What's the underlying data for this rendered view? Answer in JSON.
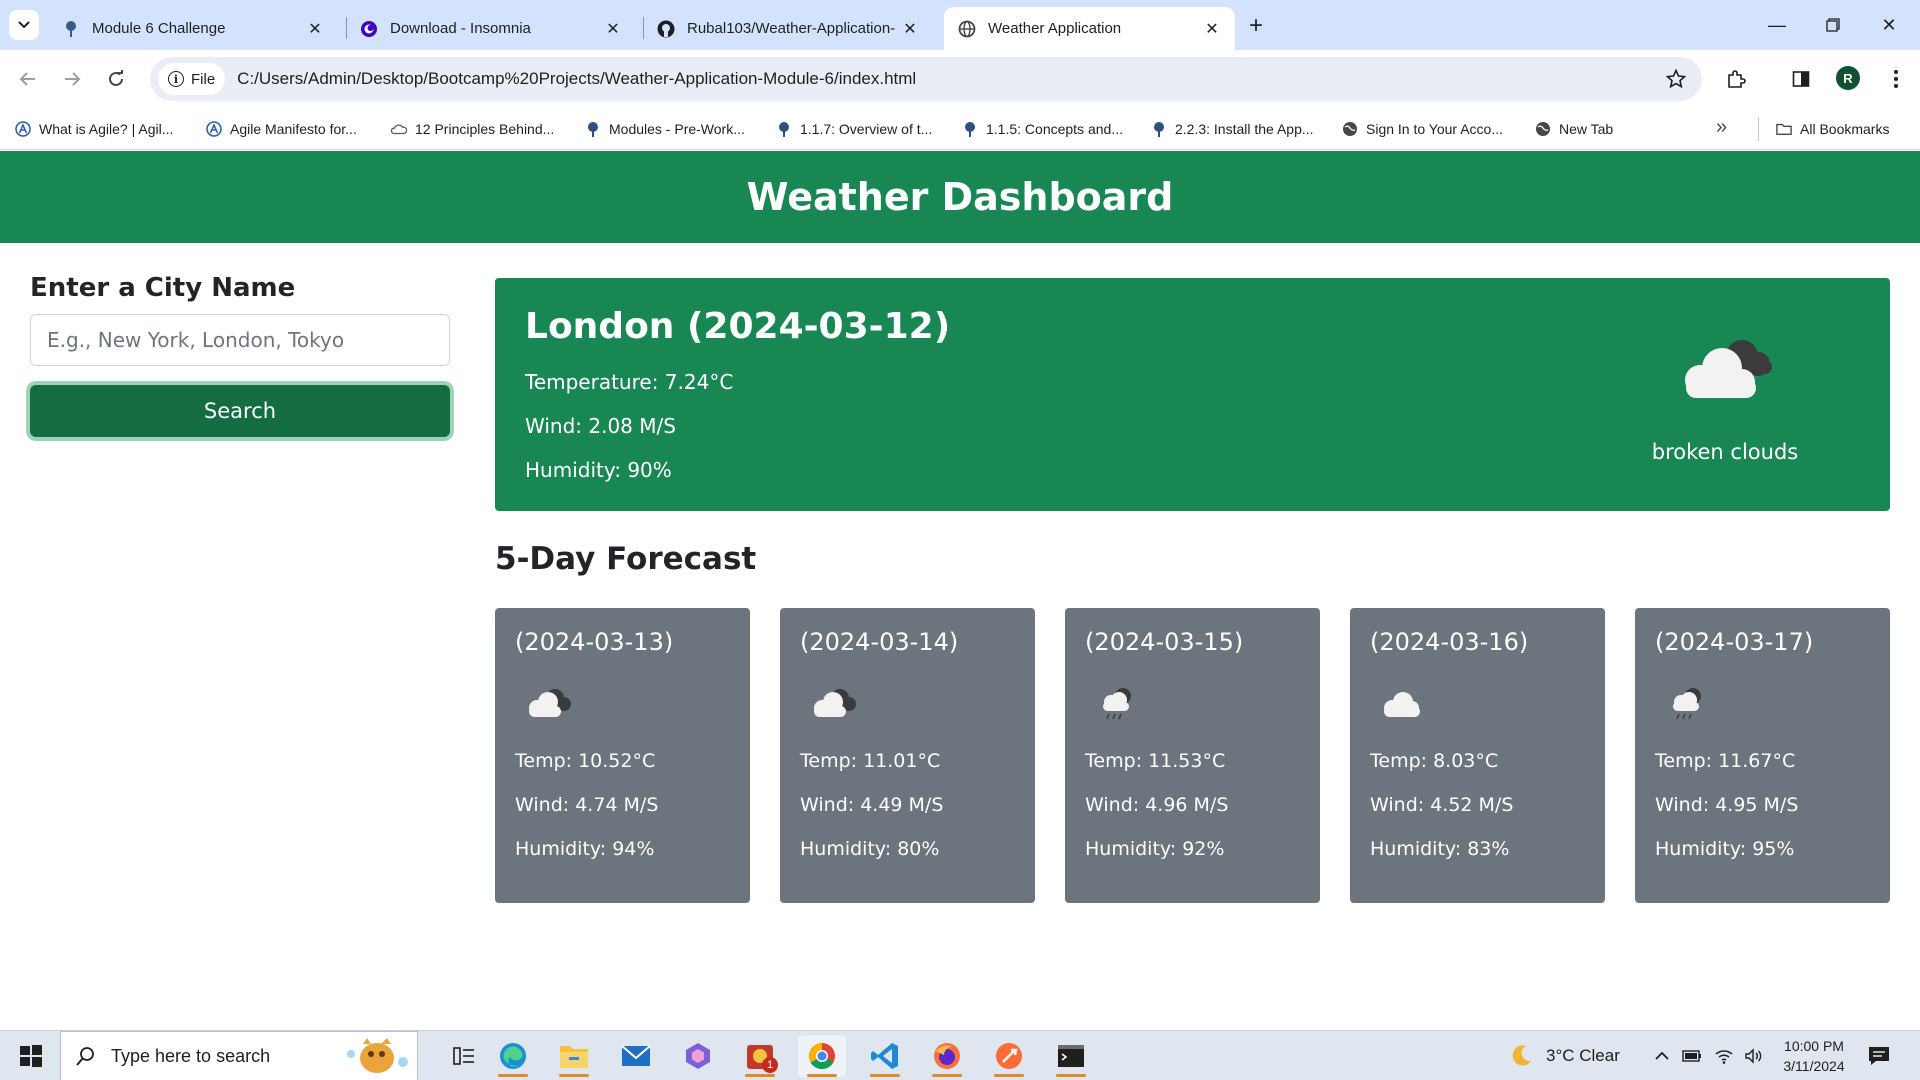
{
  "browser": {
    "tabs": [
      {
        "title": "Module 6 Challenge",
        "favicon": "tree-icon",
        "active": false
      },
      {
        "title": "Download - Insomnia",
        "favicon": "insomnia-icon",
        "active": false
      },
      {
        "title": "Rubal103/Weather-Application-",
        "favicon": "github-icon",
        "active": false
      },
      {
        "title": "Weather Application",
        "favicon": "globe-icon",
        "active": true
      }
    ],
    "url_scheme_label": "File",
    "url": "C:/Users/Admin/Desktop/Bootcamp%20Projects/Weather-Application-Module-6/index.html",
    "profile_initial": "R",
    "bookmarks": [
      {
        "label": "What is Agile? | Agil...",
        "icon": "agile-icon"
      },
      {
        "label": "Agile Manifesto for...",
        "icon": "agile-icon"
      },
      {
        "label": "12 Principles Behind...",
        "icon": "cloud-bookmark-icon"
      },
      {
        "label": "Modules - Pre-Work...",
        "icon": "tree-icon"
      },
      {
        "label": "1.1.7: Overview of t...",
        "icon": "tree-icon"
      },
      {
        "label": "1.1.5: Concepts and...",
        "icon": "tree-icon"
      },
      {
        "label": "2.2.3: Install the App...",
        "icon": "tree-icon"
      },
      {
        "label": "Sign In to Your Acco...",
        "icon": "globe-icon"
      },
      {
        "label": "New Tab",
        "icon": "globe-icon"
      }
    ],
    "all_bookmarks_label": "All Bookmarks"
  },
  "app": {
    "title": "Weather Dashboard",
    "sidebar": {
      "label": "Enter a City Name",
      "input_value": "",
      "input_placeholder": "E.g., New York, London, Tokyo",
      "search_label": "Search"
    },
    "current": {
      "heading": "London (2024-03-12)",
      "temperature": "Temperature: 7.24°C",
      "wind": "Wind: 2.08 M/S",
      "humidity": "Humidity: 90%",
      "icon": "broken-clouds-icon",
      "description": "broken clouds"
    },
    "forecast_title": "5-Day Forecast",
    "forecast": [
      {
        "date": "(2024-03-13)",
        "icon": "broken-clouds-icon",
        "temp": "Temp: 10.52°C",
        "wind": "Wind: 4.74 M/S",
        "humidity": "Humidity: 94%"
      },
      {
        "date": "(2024-03-14)",
        "icon": "broken-clouds-icon",
        "temp": "Temp: 11.01°C",
        "wind": "Wind: 4.49 M/S",
        "humidity": "Humidity: 80%"
      },
      {
        "date": "(2024-03-15)",
        "icon": "rain-icon",
        "temp": "Temp: 11.53°C",
        "wind": "Wind: 4.96 M/S",
        "humidity": "Humidity: 92%"
      },
      {
        "date": "(2024-03-16)",
        "icon": "cloud-icon",
        "temp": "Temp: 8.03°C",
        "wind": "Wind: 4.52 M/S",
        "humidity": "Humidity: 83%"
      },
      {
        "date": "(2024-03-17)",
        "icon": "rain-icon",
        "temp": "Temp: 11.67°C",
        "wind": "Wind: 4.95 M/S",
        "humidity": "Humidity: 95%"
      }
    ]
  },
  "taskbar": {
    "search_placeholder": "Type here to search",
    "weather": "3°C  Clear",
    "time": "10:00 PM",
    "date": "3/11/2024",
    "badge": "1"
  },
  "colors": {
    "header_green": "#198754",
    "button_green": "#146c43",
    "card_gray": "#6c757d",
    "tabstrip": "#d3e3fd"
  }
}
